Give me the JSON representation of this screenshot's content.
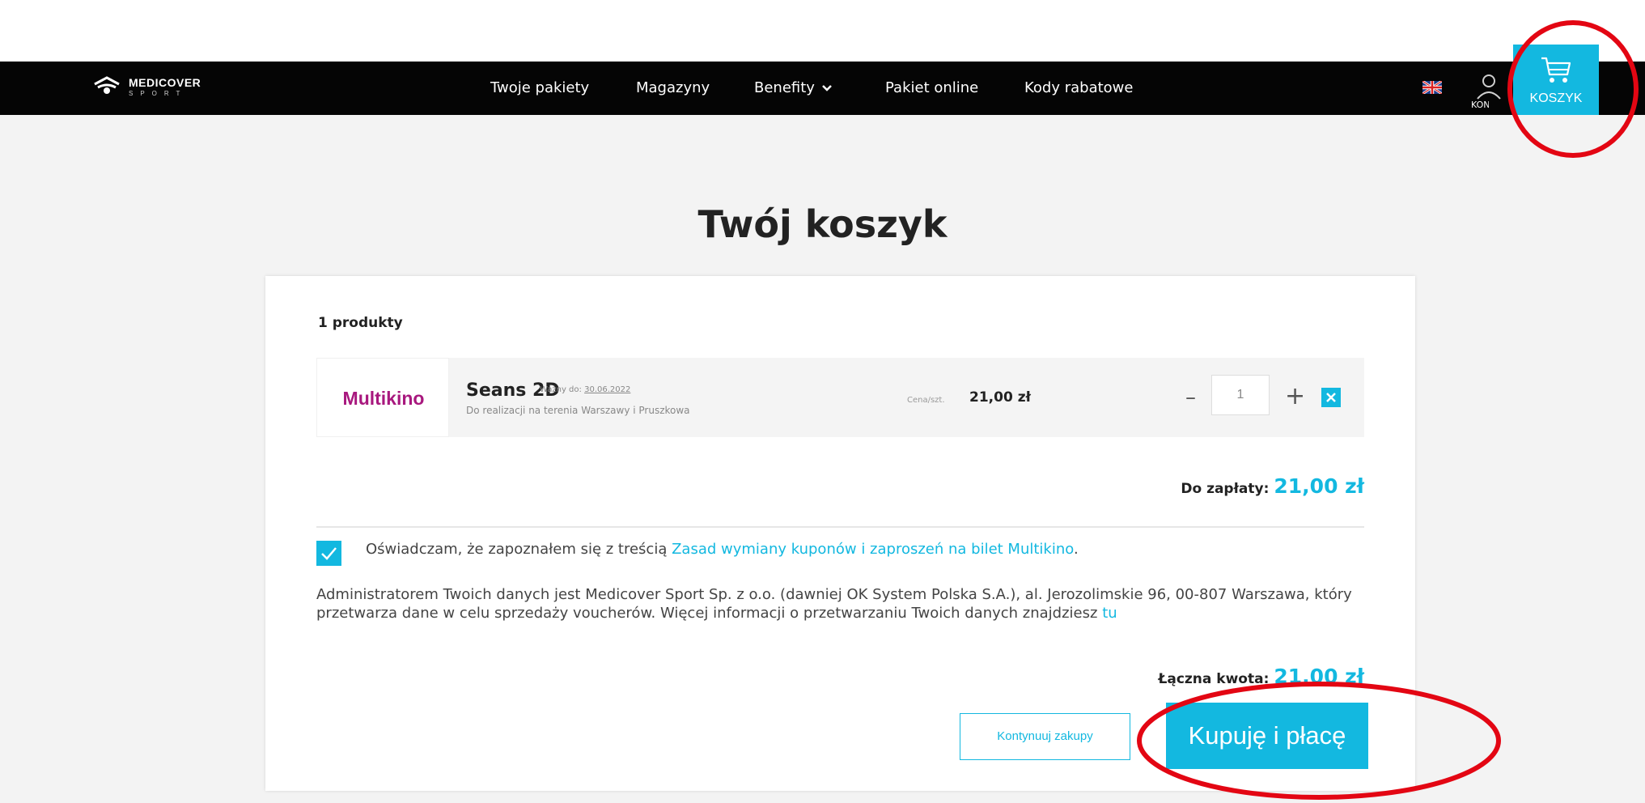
{
  "brand": {
    "name": "MEDICOVER",
    "sub": "SPORT"
  },
  "nav": {
    "items": [
      "Twoje pakiety",
      "Magazyny",
      "Benefity",
      "Pakiet online",
      "Kody rabatowe"
    ],
    "account_label": "KONTO",
    "cart_label": "KOSZYK"
  },
  "page": {
    "title": "Twój koszyk"
  },
  "cart": {
    "count_label": "1 produkty",
    "product": {
      "brand": "Multikino",
      "name": "Seans 2D",
      "valid_label": "Ważny do:",
      "valid_date": "30.06.2022",
      "description": "Do realizacji na terenia Warszawy i Pruszkowa",
      "unit_label": "Cena/szt.",
      "unit_price": "21,00 zł",
      "quantity": "1",
      "minus": "–",
      "plus": "+"
    },
    "to_pay_label": "Do zapłaty:",
    "to_pay_value": "21,00 zł",
    "consent_text": "Oświadczam, że zapoznałem się z treścią",
    "consent_link": "Zasad wymiany kuponów i zaproszeń na bilet Multikino",
    "consent_end": ".",
    "admin_text": "Administratorem Twoich danych jest Medicover Sport Sp. z o.o. (dawniej OK System Polska S.A.), al. Jerozolimskie 96, 00-807 Warszawa, który przetwarza dane w celu sprzedaży voucherów. Więcej informacji o przetwarzaniu Twoich danych znajdziesz",
    "admin_link": "tu",
    "total_label": "Łączna kwota:",
    "total_value": "21,00 zł",
    "continue_label": "Kontynuuj zakupy",
    "buy_label": "Kupuję i płacę"
  },
  "colors": {
    "accent": "#13b8e0",
    "navbar": "#050505",
    "brand_magenta": "#a8187e",
    "annotation_red": "#e30613"
  },
  "icons": [
    "medicover-logo-icon",
    "chevron-down-icon",
    "uk-flag-icon",
    "user-icon",
    "cart-icon",
    "close-icon",
    "check-icon"
  ]
}
